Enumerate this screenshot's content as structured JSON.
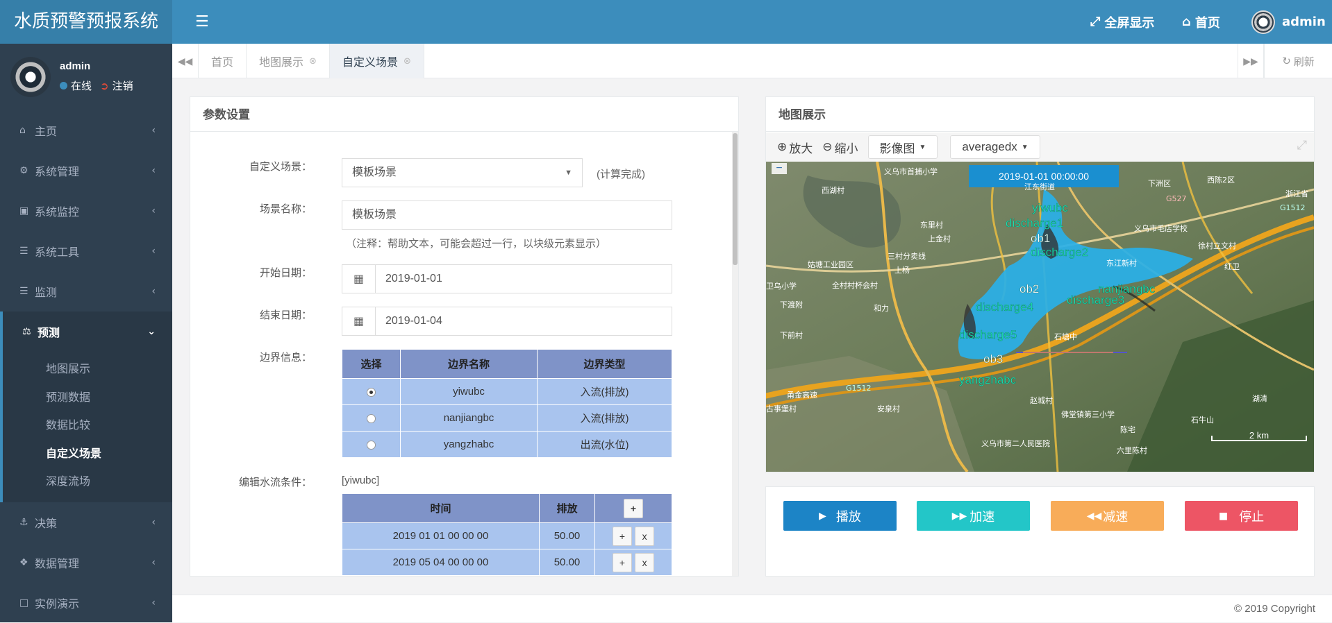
{
  "app": {
    "title": "水质预警预报系统"
  },
  "topnav": {
    "fullscreen": "全屏显示",
    "home": "首页",
    "user": "admin"
  },
  "user": {
    "name": "admin",
    "status": "在线",
    "logout": "注销"
  },
  "sidebar": {
    "items": [
      {
        "label": "主页",
        "icon": "home-icon"
      },
      {
        "label": "系统管理",
        "icon": "gear-icon"
      },
      {
        "label": "系统监控",
        "icon": "video-icon"
      },
      {
        "label": "系统工具",
        "icon": "list-icon"
      },
      {
        "label": "监测",
        "icon": "database-icon"
      },
      {
        "label": "预测",
        "icon": "scale-icon"
      },
      {
        "label": "决策",
        "icon": "anchor-icon"
      },
      {
        "label": "数据管理",
        "icon": "cubes-icon"
      },
      {
        "label": "实例演示",
        "icon": "desktop-icon"
      }
    ],
    "subitems": [
      "地图展示",
      "预测数据",
      "数据比较",
      "自定义场景",
      "深度流场"
    ]
  },
  "tabs": [
    {
      "label": "首页"
    },
    {
      "label": "地图展示"
    },
    {
      "label": "自定义场景"
    }
  ],
  "tabbar": {
    "refresh": "刷新"
  },
  "params": {
    "title": "参数设置",
    "scene_label": "自定义场景：",
    "scene_value": "模板场景",
    "scene_status": "(计算完成)",
    "name_label": "场景名称：",
    "name_value": "模板场景",
    "name_help": "（注释：帮助文本，可能会超过一行，以块级元素显示）",
    "start_label": "开始日期：",
    "start_value": "2019-01-01",
    "end_label": "结束日期：",
    "end_value": "2019-01-04",
    "boundary_label": "边界信息：",
    "boundary_headers": [
      "选择",
      "边界名称",
      "边界类型"
    ],
    "boundary_rows": [
      {
        "name": "yiwubc",
        "type": "入流(排放)",
        "selected": true
      },
      {
        "name": "nanjiangbc",
        "type": "入流(排放)",
        "selected": false
      },
      {
        "name": "yangzhabc",
        "type": "出流(水位)",
        "selected": false
      }
    ],
    "flow_label": "编辑水流条件：",
    "flow_selected": "[yiwubc]",
    "flow_headers": [
      "时间",
      "排放",
      "+"
    ],
    "flow_rows": [
      {
        "time": "2019 01 01 00 00 00",
        "value": "50.00"
      },
      {
        "time": "2019 05 04 00 00 00",
        "value": "50.00"
      }
    ],
    "row_add": "+",
    "row_del": "x"
  },
  "map": {
    "title": "地图展示",
    "zoom_in": "放大",
    "zoom_out": "缩小",
    "layer": "影像图",
    "variable": "averagedx",
    "timestamp": "2019-01-01 00:00:00",
    "scale": "2 km",
    "labels": [
      "yiwubc",
      "discharge1",
      "ob1",
      "discharge2",
      "nanjiangbc",
      "ob2",
      "discharge3",
      "discharge4",
      "discharge5",
      "ob3",
      "yangzhabc"
    ],
    "place_names": [
      "义乌市首捕小学",
      "江东街道",
      "下洲区",
      "西陈2区",
      "浙江省",
      "西湖村",
      "G527",
      "G1512",
      "东里村",
      "义乌市毛店学校",
      "上金村",
      "徐村立文村",
      "姑塘工业园区",
      "三村分卖线",
      "全村村杯会村",
      "红卫",
      "东江新村",
      "下前村",
      "卫乌小学",
      "上杨",
      "和力",
      "石塘中",
      "下渡附",
      "古事堡村",
      "安泉村",
      "赵城村",
      "佛堂镇第三小学",
      "陈宅",
      "义乌市第二人民医院",
      "六里陈村",
      "湖清",
      "石牛山",
      "甬金高速",
      "G1512"
    ]
  },
  "controls": {
    "play": "播放",
    "faster": "加速",
    "slower": "减速",
    "stop": "停止"
  },
  "footer": {
    "copyright": "© 2019 Copyright"
  }
}
